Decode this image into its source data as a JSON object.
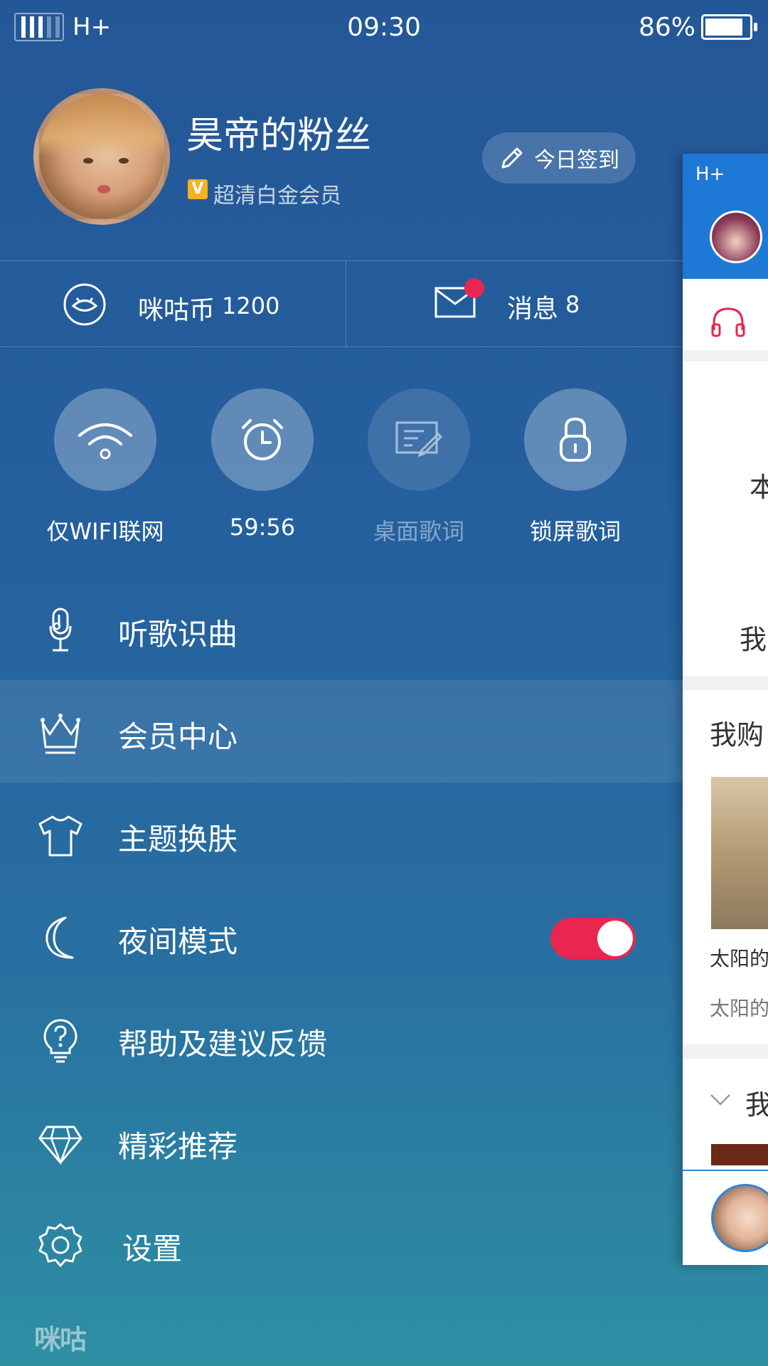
{
  "status_bar": {
    "network": "H+",
    "time": "09:30",
    "battery": "86%",
    "battery_level": 0.86
  },
  "profile": {
    "username": "昊帝的粉丝",
    "badge": "V",
    "member_level": "超清白金会员",
    "checkin_label": "今日签到"
  },
  "stats": {
    "coin_label": "咪咕币",
    "coin_value": "1200",
    "message_label": "消息",
    "message_count": "8"
  },
  "quick_toggles": [
    {
      "label": "仅WIFI联网",
      "icon": "wifi-icon",
      "state": "on"
    },
    {
      "label": "59:56",
      "icon": "alarm-clock-icon",
      "state": "on"
    },
    {
      "label": "桌面歌词",
      "icon": "desktop-lyrics-icon",
      "state": "off"
    },
    {
      "label": "锁屏歌词",
      "icon": "lock-icon",
      "state": "on"
    }
  ],
  "menu": [
    {
      "label": "听歌识曲",
      "icon": "microphone-music-icon"
    },
    {
      "label": "会员中心",
      "icon": "crown-icon",
      "active": true
    },
    {
      "label": "主题换肤",
      "icon": "tshirt-icon"
    },
    {
      "label": "夜间模式",
      "icon": "moon-icon",
      "toggle": true
    },
    {
      "label": "帮助及建议反馈",
      "icon": "question-bulb-icon"
    },
    {
      "label": "精彩推荐",
      "icon": "diamond-icon"
    },
    {
      "label": "设置",
      "icon": "gear-icon"
    }
  ],
  "brand": "咪咕",
  "peek": {
    "status": "H+",
    "tab_text": "本",
    "row1": "本",
    "row2": "我",
    "section": "我购",
    "song_title": "太阳的",
    "song_sub": "太阳的",
    "section2": "我"
  },
  "colors": {
    "accent": "#e8264f",
    "panel_top": "#245797",
    "panel_bottom": "#2e8fa3"
  }
}
